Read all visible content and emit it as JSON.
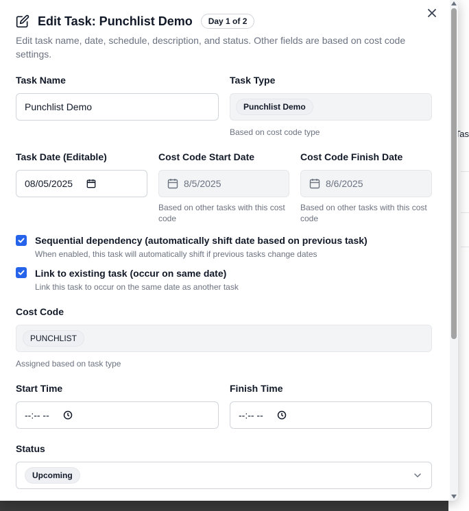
{
  "header": {
    "title": "Edit Task: Punchlist Demo",
    "day_badge": "Day 1 of 2",
    "description": "Edit task name, date, schedule, description, and status. Other fields are based on cost code settings."
  },
  "background": {
    "peek_text": "Tas"
  },
  "task_name": {
    "label": "Task Name",
    "value": "Punchlist Demo"
  },
  "task_type": {
    "label": "Task Type",
    "value": "Punchlist Demo",
    "help": "Based on cost code type"
  },
  "task_date": {
    "label": "Task Date (Editable)",
    "value": "08/05/2025"
  },
  "cost_code_start": {
    "label": "Cost Code Start Date",
    "value": "8/5/2025",
    "help": "Based on other tasks with this cost code"
  },
  "cost_code_finish": {
    "label": "Cost Code Finish Date",
    "value": "8/6/2025",
    "help": "Based on other tasks with this cost code"
  },
  "sequential": {
    "label": "Sequential dependency (automatically shift date based on previous task)",
    "help": "When enabled, this task will automatically shift if previous tasks change dates",
    "checked": true
  },
  "link": {
    "label": "Link to existing task (occur on same date)",
    "help": "Link this task to occur on the same date as another task",
    "checked": true
  },
  "cost_code": {
    "label": "Cost Code",
    "value": "PUNCHLIST",
    "help": "Assigned based on task type"
  },
  "start_time": {
    "label": "Start Time",
    "value": "--:-- --"
  },
  "finish_time": {
    "label": "Finish Time",
    "value": "--:-- --"
  },
  "status": {
    "label": "Status",
    "value": "Upcoming"
  },
  "colors": {
    "accent": "#2563eb",
    "muted_text": "#6b7280",
    "readonly_bg": "#f3f4f6"
  }
}
